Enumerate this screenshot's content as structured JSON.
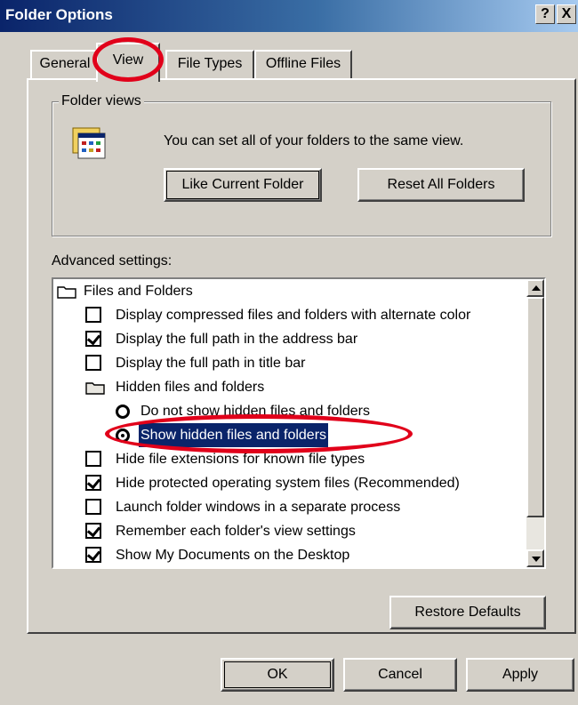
{
  "window": {
    "title": "Folder Options",
    "help_button": "?",
    "close_button": "X"
  },
  "tabs": [
    {
      "label": "General"
    },
    {
      "label": "View"
    },
    {
      "label": "File Types"
    },
    {
      "label": "Offline Files"
    }
  ],
  "folder_views": {
    "group_label": "Folder views",
    "description": "You can set all of your folders to the same view.",
    "like_current_button": "Like Current Folder",
    "reset_all_button": "Reset All Folders",
    "icon": "folder-views-icon"
  },
  "advanced": {
    "label": "Advanced settings:",
    "items": [
      {
        "type": "folder",
        "label": "Files and Folders"
      },
      {
        "type": "checkbox",
        "checked": false,
        "label": "Display compressed files and folders with alternate color"
      },
      {
        "type": "checkbox",
        "checked": true,
        "label": "Display the full path in the address bar"
      },
      {
        "type": "checkbox",
        "checked": false,
        "label": "Display the full path in title bar"
      },
      {
        "type": "folder",
        "label": "Hidden files and folders"
      },
      {
        "type": "radio",
        "checked": false,
        "label": "Do not show hidden files and folders"
      },
      {
        "type": "radio",
        "checked": true,
        "selected": true,
        "label": "Show hidden files and folders"
      },
      {
        "type": "checkbox",
        "checked": false,
        "label": "Hide file extensions for known file types"
      },
      {
        "type": "checkbox",
        "checked": true,
        "label": "Hide protected operating system files (Recommended)"
      },
      {
        "type": "checkbox",
        "checked": false,
        "label": "Launch folder windows in a separate process"
      },
      {
        "type": "checkbox",
        "checked": true,
        "label": "Remember each folder's view settings"
      },
      {
        "type": "checkbox",
        "checked": true,
        "label": "Show My Documents on the Desktop"
      }
    ]
  },
  "restore_defaults_button": "Restore Defaults",
  "footer": {
    "ok": "OK",
    "cancel": "Cancel",
    "apply": "Apply"
  },
  "colors": {
    "titlebar": "#0a246a",
    "dialog": "#d4d0c8",
    "annotation": "#e1001a",
    "selection": "#0a246a"
  }
}
